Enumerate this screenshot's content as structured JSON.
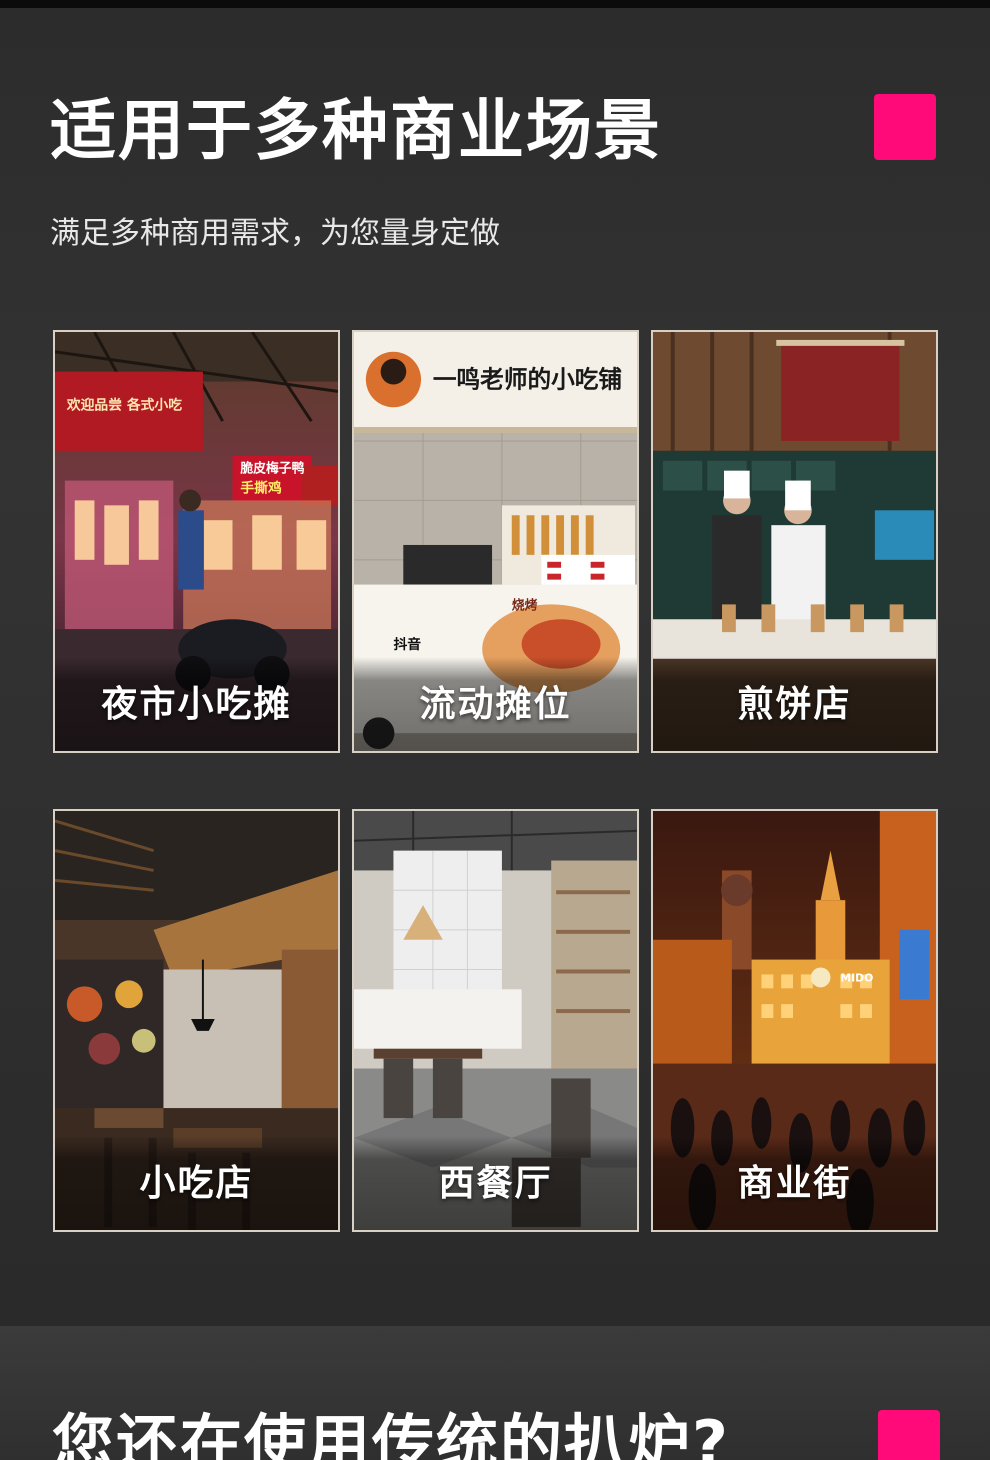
{
  "section_1": {
    "title": "适用于多种商业场景",
    "subtitle": "满足多种商用需求，为您量身定做",
    "accent_color": "#ff0a78",
    "cards": [
      {
        "label": "夜市小吃摊",
        "photo_signage": [
          "欢迎品尝 各式小吃",
          "脆皮梅子鸭",
          "手撕鸡"
        ]
      },
      {
        "label": "流动摊位",
        "photo_signage": [
          "一鸣老师的小吃铺",
          "抖音",
          "烧烤"
        ]
      },
      {
        "label": "煎饼店"
      },
      {
        "label": "小吃店"
      },
      {
        "label": "西餐厅"
      },
      {
        "label": "商业街",
        "photo_signage": [
          "MIDO"
        ]
      }
    ]
  },
  "section_2": {
    "title": "您还在使用传统的扒炉?"
  }
}
